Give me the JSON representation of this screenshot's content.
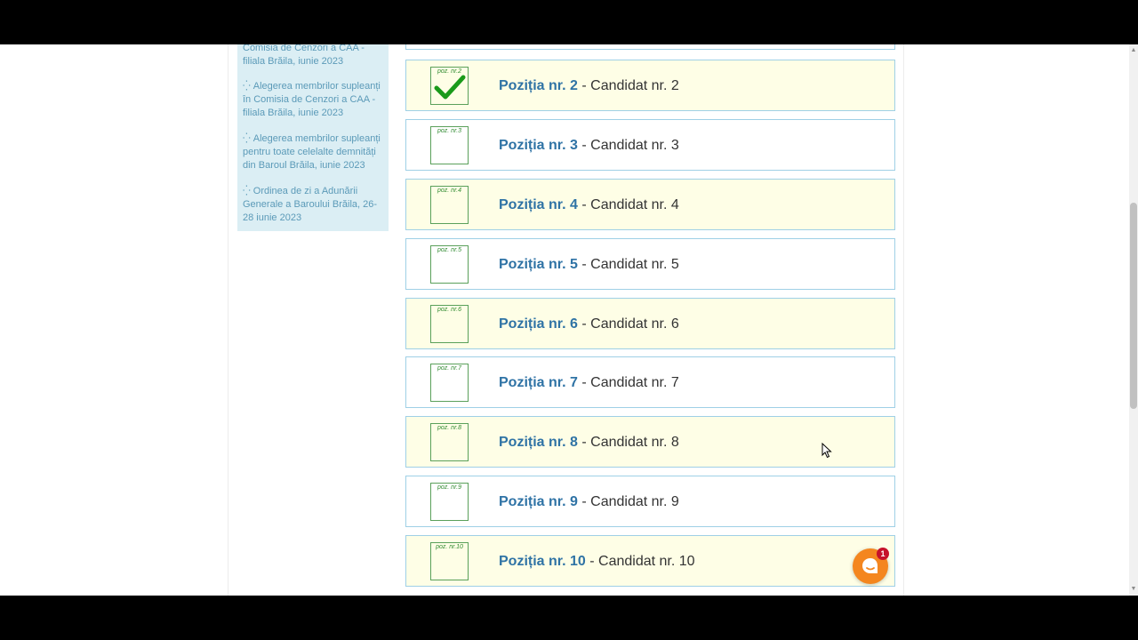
{
  "sidebar": {
    "items": [
      {
        "text": "Comisia de Cenzori a CAA - filiala Brăila, iunie 2023",
        "bullet": ""
      },
      {
        "text": "Alegerea membrilor supleanți în Comisia de Cenzori a CAA - filiala Brăila, iunie 2023",
        "bullet": "⁛"
      },
      {
        "text": "Alegerea membrilor supleanți pentru toate celelalte demnități din Baroul Brăila, iunie 2023",
        "bullet": "⁛"
      },
      {
        "text": "Ordinea de zi a Adunării Generale a Baroului Brăila, 26-28 iunie 2023",
        "bullet": "⁛"
      }
    ]
  },
  "ballot": {
    "rows": [
      {
        "poz": "poz. nr.2",
        "position": "Poziția nr. 2",
        "sep": " - ",
        "candidate": "Candidat nr. 2",
        "checked": true
      },
      {
        "poz": "poz. nr.3",
        "position": "Poziția nr. 3",
        "sep": " - ",
        "candidate": "Candidat nr. 3",
        "checked": false
      },
      {
        "poz": "poz. nr.4",
        "position": "Poziția nr. 4",
        "sep": " - ",
        "candidate": "Candidat nr. 4",
        "checked": false
      },
      {
        "poz": "poz. nr.5",
        "position": "Poziția nr. 5",
        "sep": " - ",
        "candidate": "Candidat nr. 5",
        "checked": false
      },
      {
        "poz": "poz. nr.6",
        "position": "Poziția nr. 6",
        "sep": " - ",
        "candidate": "Candidat nr. 6",
        "checked": false
      },
      {
        "poz": "poz. nr.7",
        "position": "Poziția nr. 7",
        "sep": " - ",
        "candidate": "Candidat nr. 7",
        "checked": false
      },
      {
        "poz": "poz. nr.8",
        "position": "Poziția nr. 8",
        "sep": " - ",
        "candidate": "Candidat nr. 8",
        "checked": false
      },
      {
        "poz": "poz. nr.9",
        "position": "Poziția nr. 9",
        "sep": " - ",
        "candidate": "Candidat nr. 9",
        "checked": false
      },
      {
        "poz": "poz. nr.10",
        "position": "Poziția nr. 10",
        "sep": " - ",
        "candidate": "Candidat nr. 10",
        "checked": false
      }
    ]
  },
  "chat": {
    "badge": "1",
    "icon": "chat-bubble-icon"
  },
  "colors": {
    "accent_blue": "#2f73a5",
    "row_highlight": "#fefee6",
    "row_border": "#9fd0e6",
    "check_green": "#1a9a1a",
    "chat_orange": "#f4861f",
    "badge_red": "#c6112a"
  }
}
